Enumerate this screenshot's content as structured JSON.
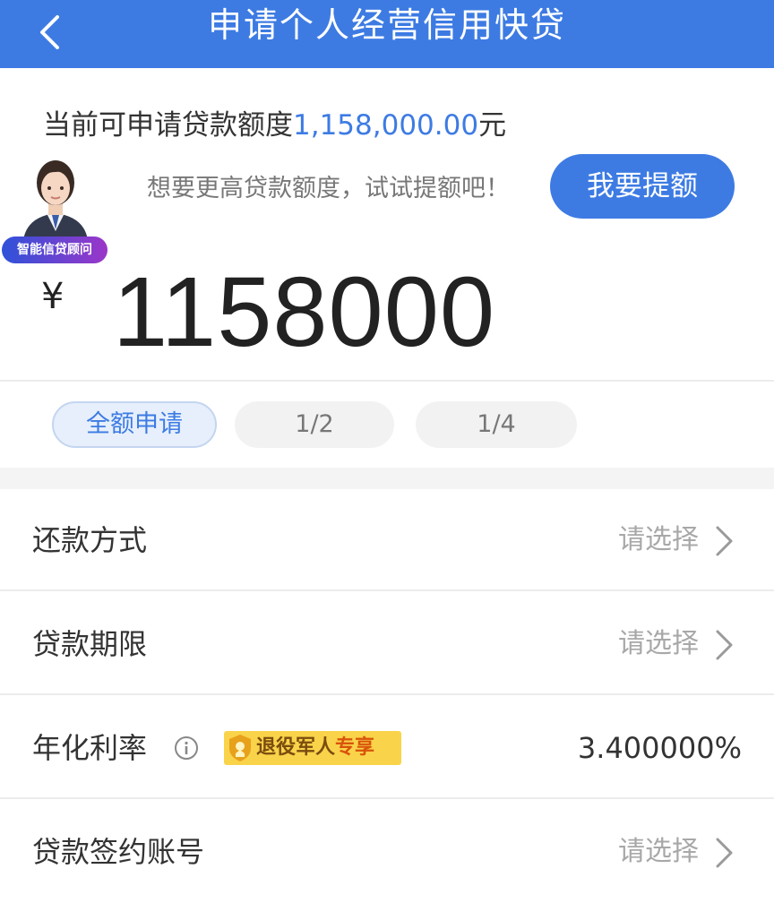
{
  "header": {
    "title": "申请个人经营信用快贷"
  },
  "quota": {
    "prefix": "当前可申请贷款额度",
    "amount": "1,158,000.00",
    "unit": "元"
  },
  "advisor": {
    "badge": "智能信贷顾问"
  },
  "boost": {
    "hint": "想要更高贷款额度，试试提额吧！",
    "button": "我要提额"
  },
  "loan": {
    "currency": "¥",
    "amount": "1158000"
  },
  "chips": {
    "full": "全额申请",
    "half": "1/2",
    "quarter": "1/4"
  },
  "rows": {
    "repayment": {
      "label": "还款方式",
      "value": "请选择"
    },
    "term": {
      "label": "贷款期限",
      "value": "请选择"
    },
    "rate": {
      "label": "年化利率",
      "badge_main": "退役军人",
      "badge_suffix": "专享",
      "value": "3.400000%"
    },
    "account": {
      "label": "贷款签约账号",
      "value": "请选择"
    }
  },
  "colors": {
    "accent": "#3d7be3",
    "badge": "#f9d34a"
  }
}
